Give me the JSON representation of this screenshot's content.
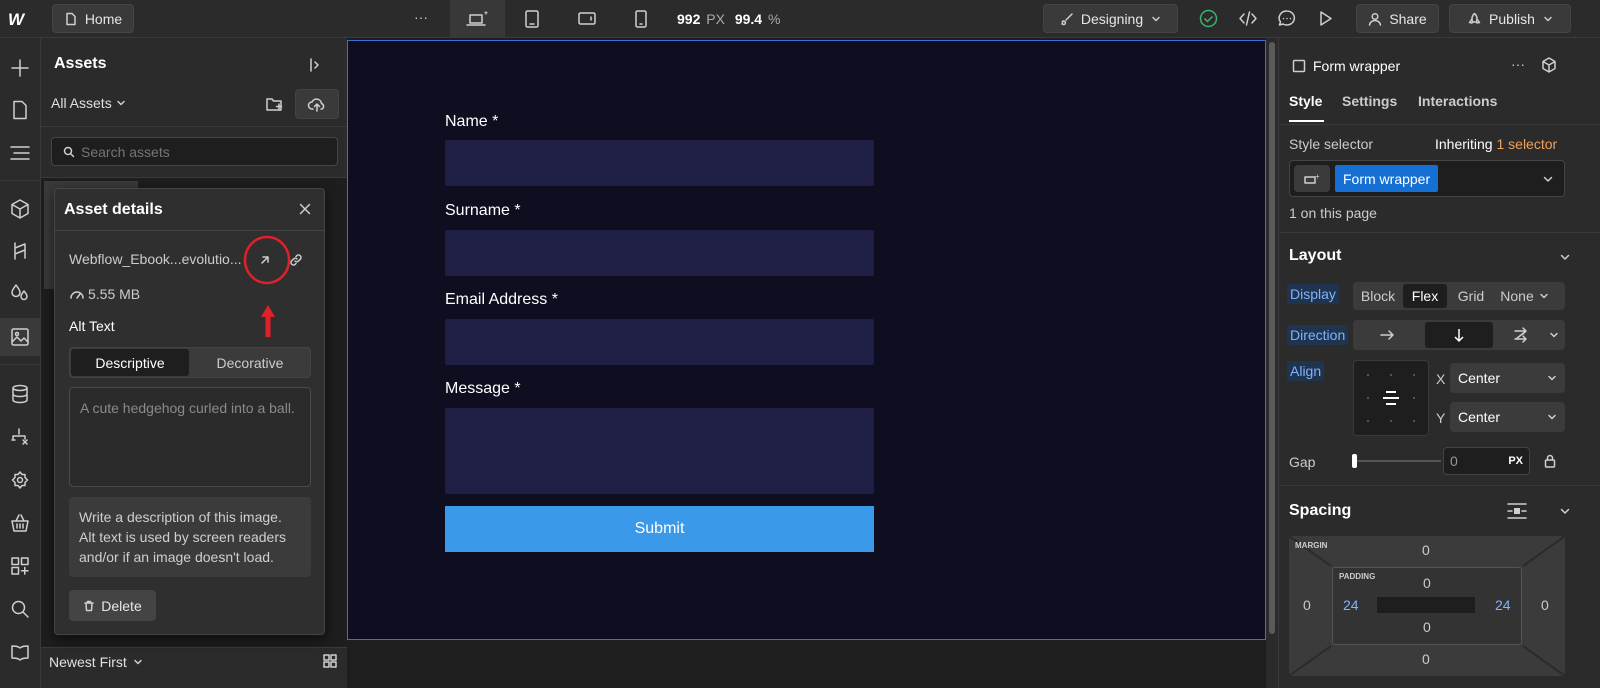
{
  "topbar": {
    "home_label": "Home",
    "more_label": "···",
    "width_value": "992",
    "width_unit": "PX",
    "zoom_value": "99.4",
    "zoom_unit": "%",
    "mode_label": "Designing",
    "share_label": "Share",
    "publish_label": "Publish"
  },
  "assets": {
    "title": "Assets",
    "filter_label": "All Assets",
    "search_placeholder": "Search assets",
    "sort_label": "Newest First"
  },
  "asset_details": {
    "title": "Asset details",
    "filename": "Webflow_Ebook...evolutio...",
    "filesize": "5.55 MB",
    "alt_text_label": "Alt Text",
    "tab_descriptive": "Descriptive",
    "tab_decorative": "Decorative",
    "alt_text_value": "A cute hedgehog curled into a ball.",
    "help_text": "Write a description of this image. Alt text is used by screen readers and/or if an image doesn't load.",
    "delete_label": "Delete"
  },
  "form": {
    "name_label": "Name *",
    "surname_label": "Surname *",
    "email_label": "Email Address *",
    "message_label": "Message *",
    "submit_label": "Submit"
  },
  "right_panel": {
    "element_name": "Form wrapper",
    "tabs": [
      "Style",
      "Settings",
      "Interactions"
    ],
    "style_selector_label": "Style selector",
    "inheriting_label": "Inheriting",
    "inheriting_count": "1 selector",
    "selector_chip": "Form wrapper",
    "on_page": "1 on this page",
    "layout_title": "Layout",
    "display_label": "Display",
    "display_options": [
      "Block",
      "Flex",
      "Grid",
      "None"
    ],
    "direction_label": "Direction",
    "align_label": "Align",
    "x_label": "X",
    "x_value": "Center",
    "y_label": "Y",
    "y_value": "Center",
    "gap_label": "Gap",
    "gap_value": "0",
    "gap_unit": "PX",
    "spacing_title": "Spacing",
    "margin_label": "MARGIN",
    "padding_label": "PADDING",
    "margin_top": "0",
    "margin_left": "0",
    "margin_right": "0",
    "margin_bottom": "0",
    "padding_top": "0",
    "padding_left": "24",
    "padding_right": "24",
    "padding_bottom": "0"
  },
  "colors": {
    "accent_blue": "#3b99ea",
    "annotation_red": "#e0202a",
    "field_bg": "#1f1e44",
    "canvas_bg": "#0f0e21"
  }
}
